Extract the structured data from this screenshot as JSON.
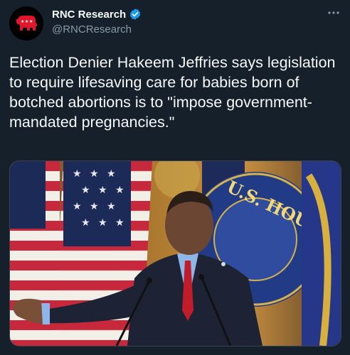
{
  "tweet": {
    "author_name": "RNC Research",
    "author_handle": "@RNCResearch",
    "text": "Election Denier Hakeem Jeffries says legislation to require lifesaving care for babies born of botched abortions is to \"impose government-mandated pregnancies.\""
  },
  "media": {
    "seal_text": "U.S. HOUSE OF REPRESENTATIVES"
  },
  "icons": {
    "avatar": "republican-elephant-logo",
    "verified": "verified-badge-icon",
    "more": "more-options-icon"
  },
  "colors": {
    "background": "#15202b",
    "text_primary": "#f7f9f9",
    "text_secondary": "#8b98a5",
    "verified_blue": "#1d9bf0",
    "avatar_red": "#e0162b"
  }
}
